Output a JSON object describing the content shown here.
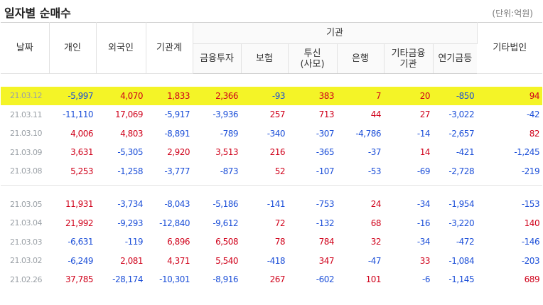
{
  "title": "일자별 순매수",
  "unit": "(단위:억원)",
  "headers": {
    "date": "날짜",
    "individual": "개인",
    "foreign": "외국인",
    "inst_total": "기관계",
    "institution": "기관",
    "financial_invest": "금융투자",
    "insurance": "보험",
    "trust_line1": "투신",
    "trust_line2": "(사모)",
    "bank": "은행",
    "other_fin_line1": "기타금융",
    "other_fin_line2": "기관",
    "pension": "연기금등",
    "other_corp": "기타법인"
  },
  "rows": [
    {
      "date": "21.03.12",
      "individual": "-5,997",
      "foreign": "4,070",
      "inst_total": "1,833",
      "financial_invest": "2,366",
      "insurance": "-93",
      "trust": "383",
      "bank": "7",
      "other_fin": "20",
      "pension": "-850",
      "other_corp": "94",
      "highlight": true
    },
    {
      "date": "21.03.11",
      "individual": "-11,110",
      "foreign": "17,069",
      "inst_total": "-5,917",
      "financial_invest": "-3,936",
      "insurance": "257",
      "trust": "713",
      "bank": "44",
      "other_fin": "27",
      "pension": "-3,022",
      "other_corp": "-42"
    },
    {
      "date": "21.03.10",
      "individual": "4,006",
      "foreign": "4,803",
      "inst_total": "-8,891",
      "financial_invest": "-789",
      "insurance": "-340",
      "trust": "-307",
      "bank": "-4,786",
      "other_fin": "-14",
      "pension": "-2,657",
      "other_corp": "82"
    },
    {
      "date": "21.03.09",
      "individual": "3,631",
      "foreign": "-5,305",
      "inst_total": "2,920",
      "financial_invest": "3,513",
      "insurance": "216",
      "trust": "-365",
      "bank": "-37",
      "other_fin": "14",
      "pension": "-421",
      "other_corp": "-1,245"
    },
    {
      "date": "21.03.08",
      "individual": "5,253",
      "foreign": "-1,258",
      "inst_total": "-3,777",
      "financial_invest": "-873",
      "insurance": "52",
      "trust": "-107",
      "bank": "-53",
      "other_fin": "-69",
      "pension": "-2,728",
      "other_corp": "-219"
    },
    {
      "date": "21.03.05",
      "individual": "11,931",
      "foreign": "-3,734",
      "inst_total": "-8,043",
      "financial_invest": "-5,186",
      "insurance": "-141",
      "trust": "-753",
      "bank": "24",
      "other_fin": "-34",
      "pension": "-1,954",
      "other_corp": "-153"
    },
    {
      "date": "21.03.04",
      "individual": "21,992",
      "foreign": "-9,293",
      "inst_total": "-12,840",
      "financial_invest": "-9,612",
      "insurance": "72",
      "trust": "-132",
      "bank": "68",
      "other_fin": "-16",
      "pension": "-3,220",
      "other_corp": "140"
    },
    {
      "date": "21.03.03",
      "individual": "-6,631",
      "foreign": "-119",
      "inst_total": "6,896",
      "financial_invest": "6,508",
      "insurance": "78",
      "trust": "784",
      "bank": "32",
      "other_fin": "-34",
      "pension": "-472",
      "other_corp": "-146"
    },
    {
      "date": "21.03.02",
      "individual": "-6,249",
      "foreign": "2,081",
      "inst_total": "4,371",
      "financial_invest": "5,540",
      "insurance": "-418",
      "trust": "347",
      "bank": "-47",
      "other_fin": "33",
      "pension": "-1,084",
      "other_corp": "-203"
    },
    {
      "date": "21.02.26",
      "individual": "37,785",
      "foreign": "-28,174",
      "inst_total": "-10,301",
      "financial_invest": "-8,916",
      "insurance": "267",
      "trust": "-602",
      "bank": "101",
      "other_fin": "-6",
      "pension": "-1,145",
      "other_corp": "689"
    }
  ],
  "colors": {
    "positive": "#d0021b",
    "negative": "#1c4fd8",
    "highlight": "#f4f427",
    "date": "#9aa0a6"
  }
}
